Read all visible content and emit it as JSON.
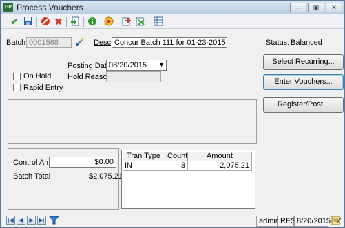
{
  "window": {
    "app_logo": "GP",
    "title": "Process Vouchers"
  },
  "toolbar": {
    "icons": [
      "save-checkmark-icon",
      "save-disk-icon",
      "cancel-icon",
      "delete-icon",
      "import-icon",
      "info-icon",
      "help-icon",
      "reports-icon",
      "transactions-icon",
      "table-icon"
    ]
  },
  "batch": {
    "label": "Batch",
    "value": "0001568",
    "desc_label": "Desc",
    "desc_value": "Concur Batch 111 for 01-23-2015"
  },
  "status": {
    "label": "Status:",
    "value": "Balanced"
  },
  "posting": {
    "date_label": "Posting Date",
    "date_value": "08/20/2015",
    "hold_label": "On Hold",
    "hold_reason_label": "Hold Reason",
    "hold_reason_value": "",
    "rapid_entry_label": "Rapid Entry"
  },
  "buttons": {
    "select_recurring": "Select Recurring...",
    "enter_vouchers": "Enter Vouchers...",
    "register_post": "Register/Post..."
  },
  "totals": {
    "control_amt_label": "Control Amt",
    "control_amt_value": "$0.00",
    "batch_total_label": "Batch Total",
    "batch_total_value": "$2,075.21"
  },
  "grid": {
    "headers": [
      "Tran Type",
      "Count",
      "Amount"
    ],
    "rows": [
      {
        "tran_type": "IN",
        "count": "3",
        "amount": "2,075.21"
      }
    ]
  },
  "statusbar": {
    "user": "admin",
    "company": "RES",
    "date": "8/20/2015"
  },
  "colors": {
    "title_bar": "#c8d8ec",
    "window_bg": "#f0f0f0",
    "accent": "#3c7fb1"
  }
}
